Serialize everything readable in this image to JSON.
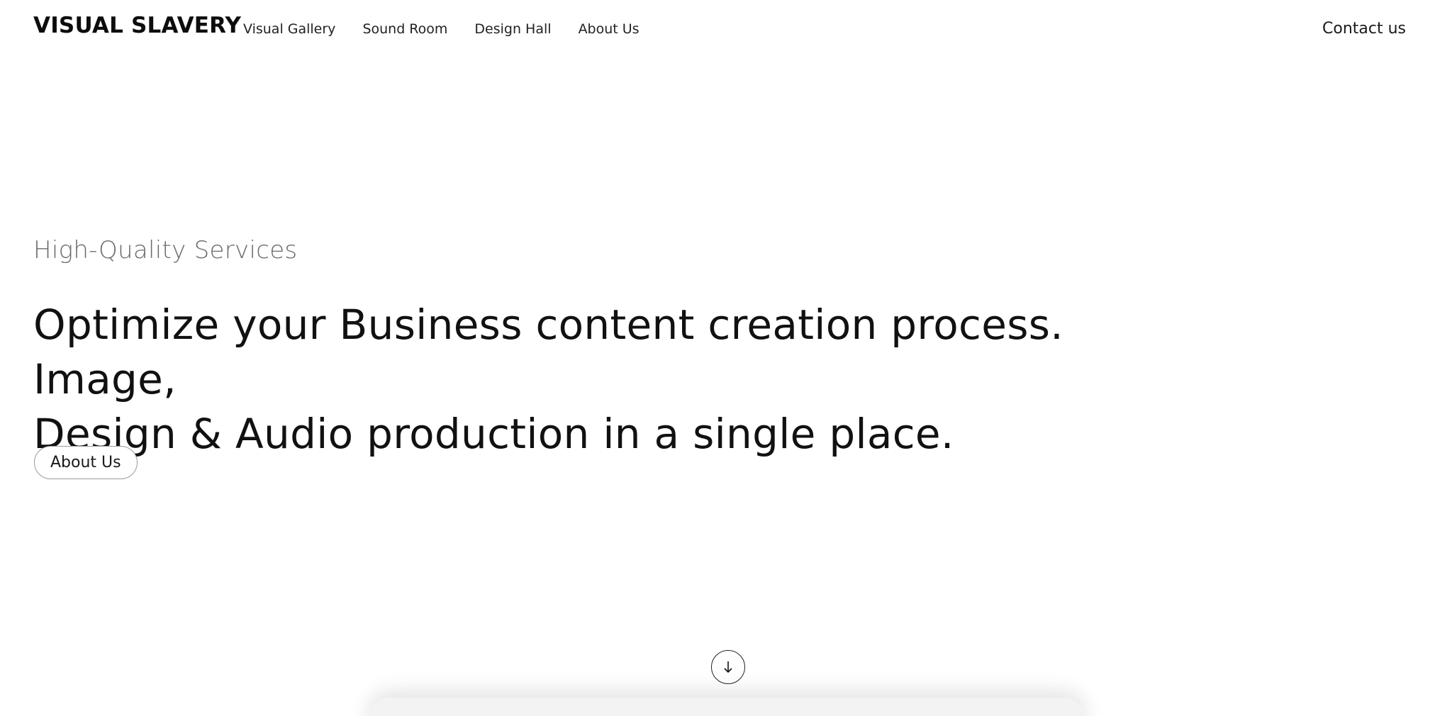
{
  "header": {
    "logo": "VISUAL SLAVERY",
    "nav": [
      {
        "label": "Visual Gallery"
      },
      {
        "label": "Sound Room"
      },
      {
        "label": "Design Hall"
      },
      {
        "label": "About Us"
      }
    ],
    "contact_label": "Contact us"
  },
  "hero": {
    "eyebrow": "High-Quality Services",
    "headline_line1": "Optimize your Business content creation process. Image,",
    "headline_line2": "Design & Audio production in a single place.",
    "button_label": "About Us"
  },
  "scroll": {
    "icon": "arrow-down-icon"
  }
}
